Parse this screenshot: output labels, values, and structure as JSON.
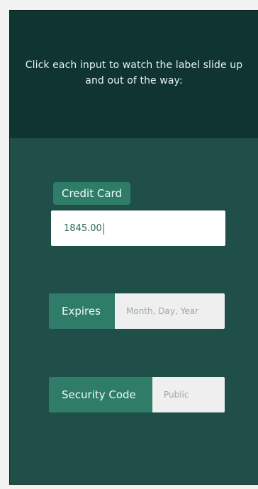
{
  "header": {
    "instruction": "Click each input to watch the label slide up and out of the way:"
  },
  "fields": {
    "credit_card": {
      "label": "Credit Card",
      "value": "1845.00"
    },
    "expires": {
      "label": "Expires",
      "placeholder": "Month, Day, Year"
    },
    "security_code": {
      "label": "Security Code",
      "placeholder": "Public"
    }
  },
  "colors": {
    "header_bg": "#0f3432",
    "panel_bg": "#1f4f48",
    "label_bg": "#2f7d69",
    "input_text": "#2a6a5b"
  }
}
